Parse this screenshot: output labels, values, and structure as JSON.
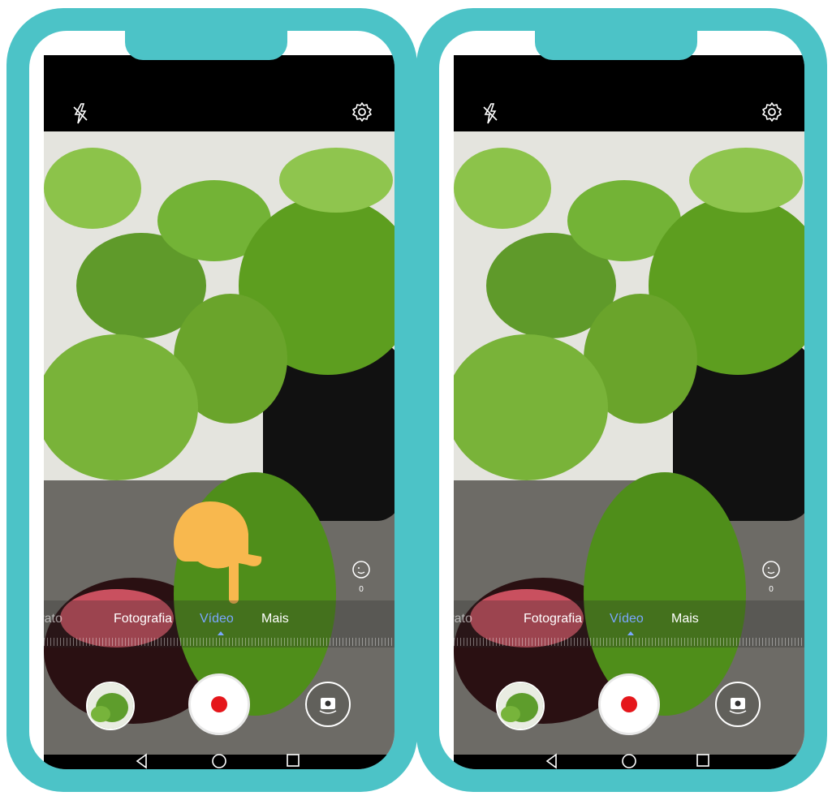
{
  "modes": {
    "retrato": "rrato",
    "fotografia": "Fotografia",
    "video": "Vídeo",
    "mais": "Mais"
  },
  "beauty_value": "0",
  "colors": {
    "frame": "#4cc3c7",
    "active_mode": "#7aa6ff",
    "record": "#e5161b",
    "pointer_hand": "#f8b84e"
  },
  "icons": [
    "flash-off-icon",
    "gear-icon",
    "beauty-icon",
    "camera-switch-icon",
    "back-icon",
    "home-icon",
    "recent-apps-icon",
    "pointing-hand-icon"
  ],
  "panels": [
    "left",
    "right"
  ]
}
